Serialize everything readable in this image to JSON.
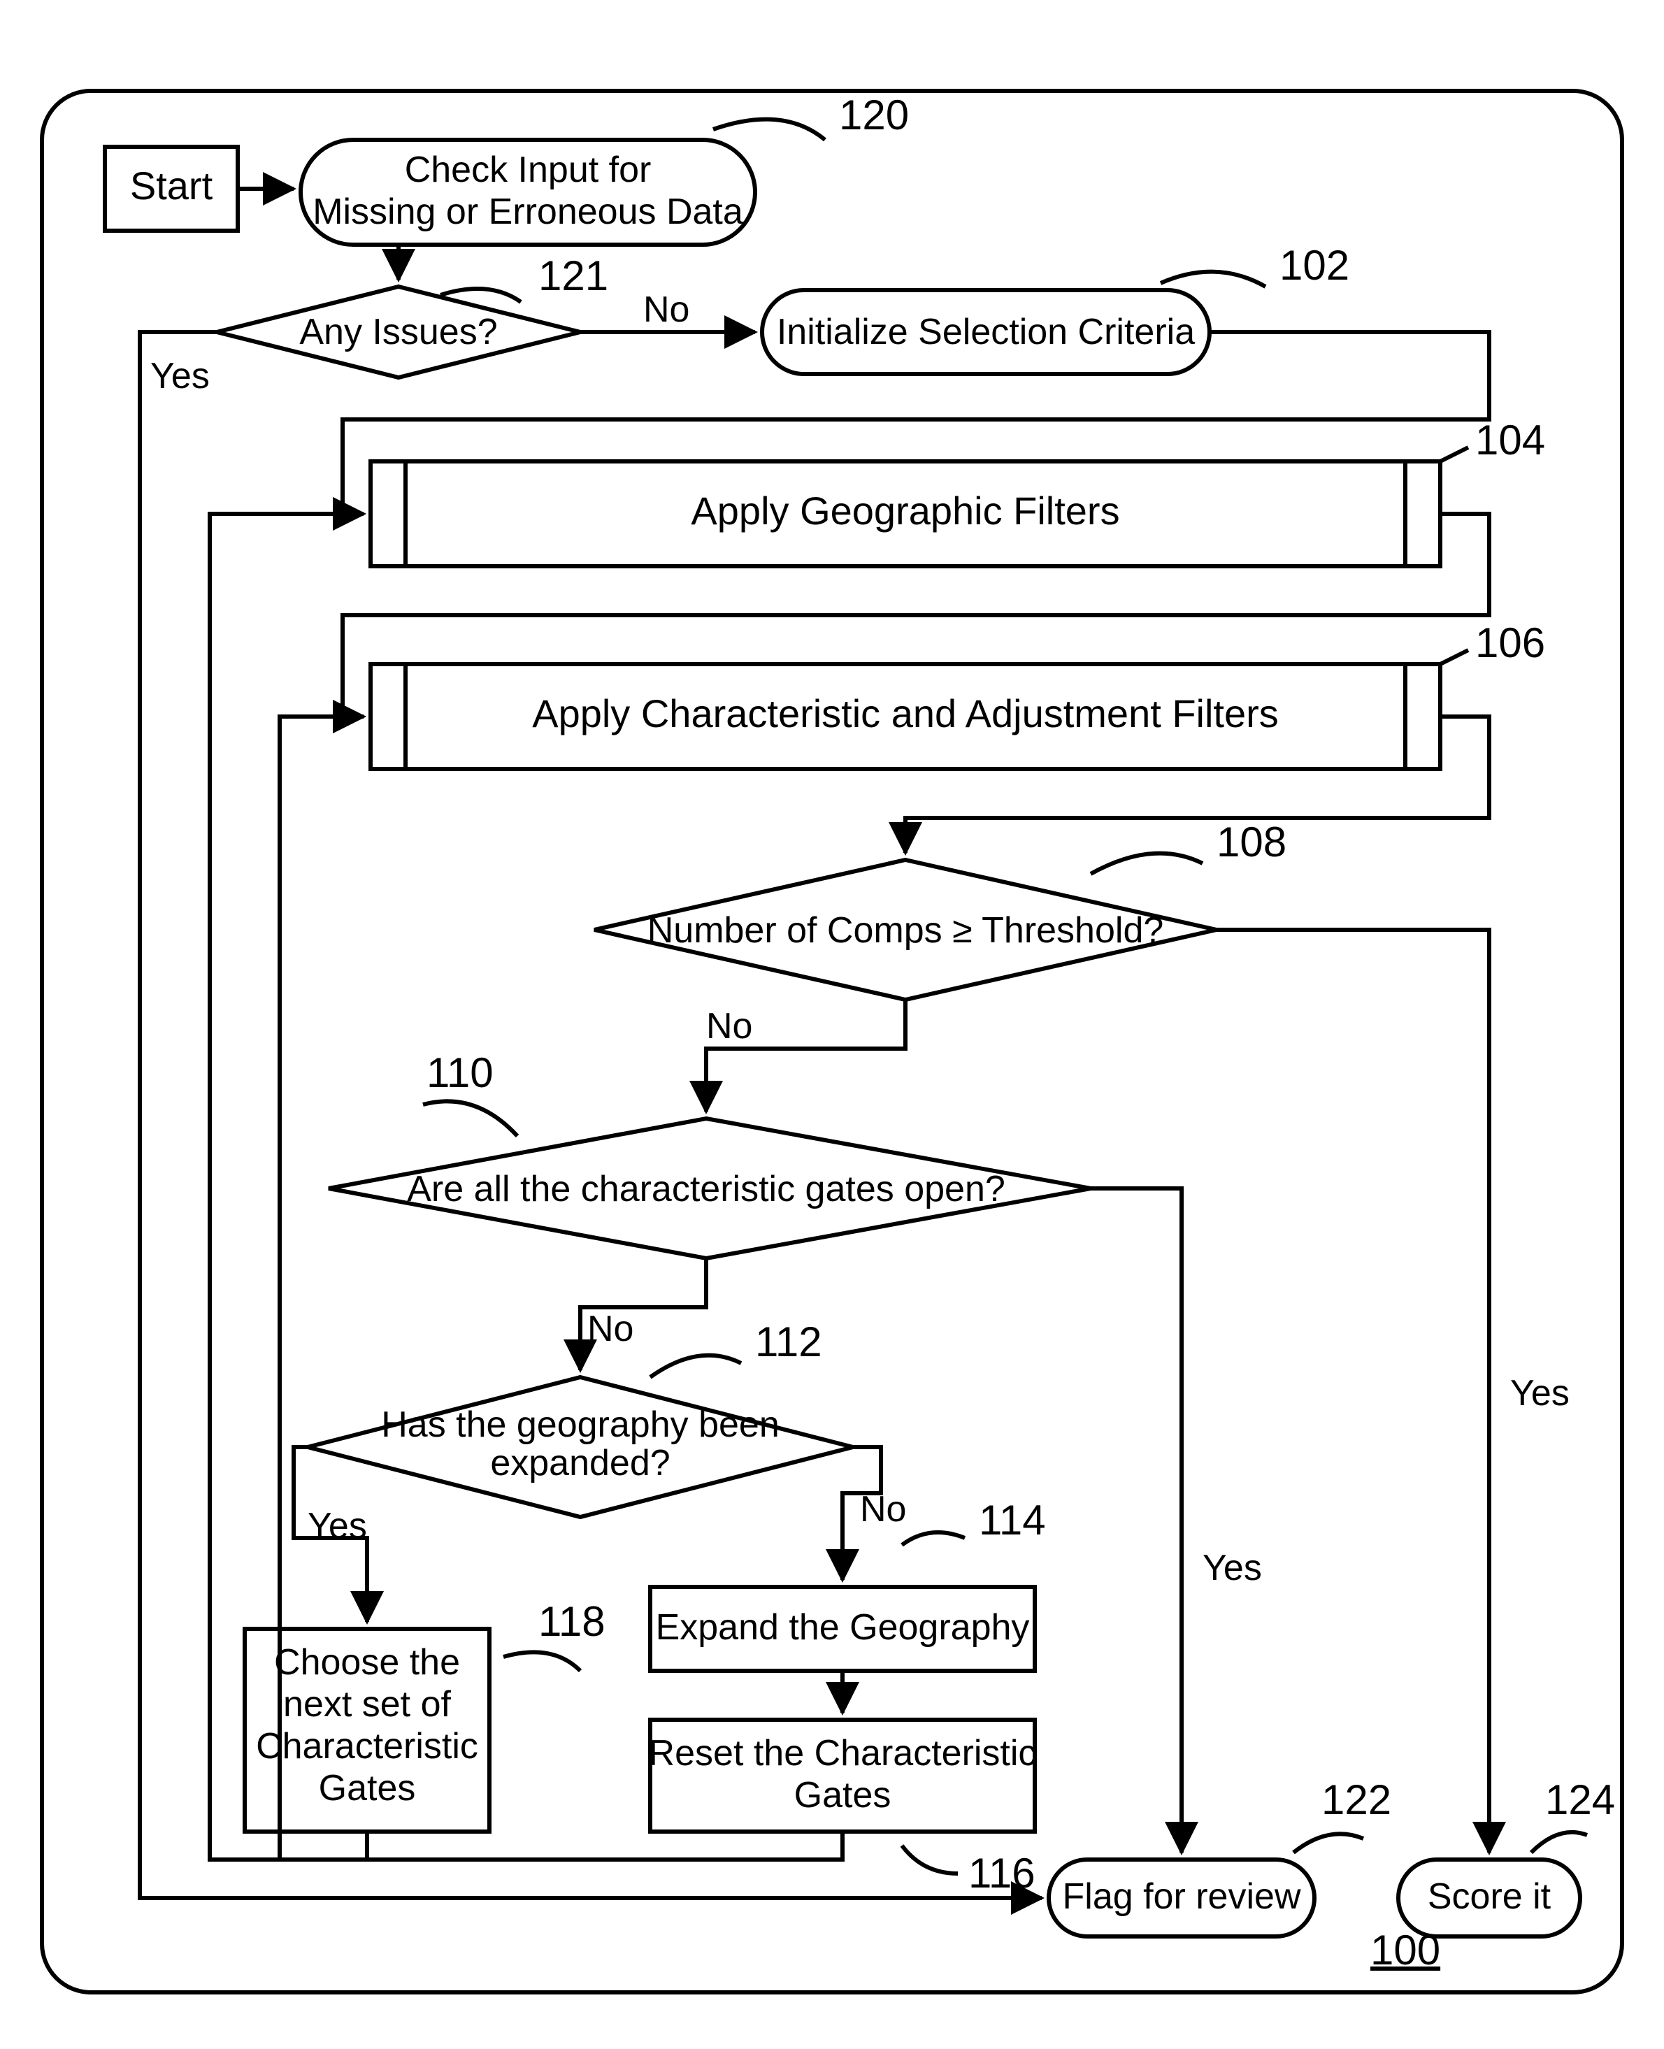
{
  "nodes": {
    "start": "Start",
    "n120_l1": "Check Input for",
    "n120_l2": "Missing or Erroneous Data",
    "n121": "Any Issues?",
    "n102": "Initialize Selection Criteria",
    "n104": "Apply Geographic Filters",
    "n106": "Apply Characteristic and Adjustment Filters",
    "n108": "Number of Comps ≥ Threshold?",
    "n110": "Are all the characteristic gates open?",
    "n112_l1": "Has the geography been",
    "n112_l2": "expanded?",
    "n114": "Expand the Geography",
    "n116_l1": "Reset the Characteristic",
    "n116_l2": "Gates",
    "n118_l1": "Choose the",
    "n118_l2": "next set of",
    "n118_l3": "Characteristic",
    "n118_l4": "Gates",
    "n122": "Flag for review",
    "n124": "Score it"
  },
  "labels": {
    "l120": "120",
    "l121": "121",
    "l102": "102",
    "l104": "104",
    "l106": "106",
    "l108": "108",
    "l110": "110",
    "l112": "112",
    "l114": "114",
    "l116": "116",
    "l118": "118",
    "l122": "122",
    "l124": "124",
    "l100": "100"
  },
  "edges": {
    "yes": "Yes",
    "no": "No"
  }
}
